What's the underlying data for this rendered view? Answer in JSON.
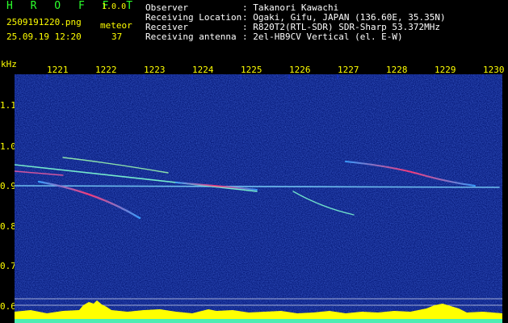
{
  "header": {
    "logo": "H R O F F T",
    "version": "1.0.0",
    "filename": "2509191220.png",
    "datetime": "25.09.19 12:20",
    "meteor_label": "meteor",
    "meteor_count": "37",
    "fields": [
      {
        "key": "Observer",
        "value": ": Takanori Kawachi"
      },
      {
        "key": "Receiving Location",
        "value": ": Ogaki, Gifu, JAPAN (136.60E, 35.35N)"
      },
      {
        "key": "Receiver",
        "value": ": R820T2(RTL-SDR) SDR-Sharp 53.372MHz"
      },
      {
        "key": "Receiving antenna",
        "value": ": 2el-HB9CV Vertical (el. E-W)"
      }
    ]
  },
  "axes": {
    "y_unit": "kHz",
    "x_ticks": [
      "1221",
      "1222",
      "1223",
      "1224",
      "1225",
      "1226",
      "1227",
      "1228",
      "1229",
      "1230"
    ],
    "y_ticks": [
      "1.1",
      "1.0",
      "0.9",
      "0.8",
      "0.7",
      "0.6"
    ]
  },
  "colors": {
    "label_yellow": "#ffff00",
    "logo_green": "#2bff2b",
    "background_noise": "#0a1a8c",
    "activity": "#ffff00"
  }
}
